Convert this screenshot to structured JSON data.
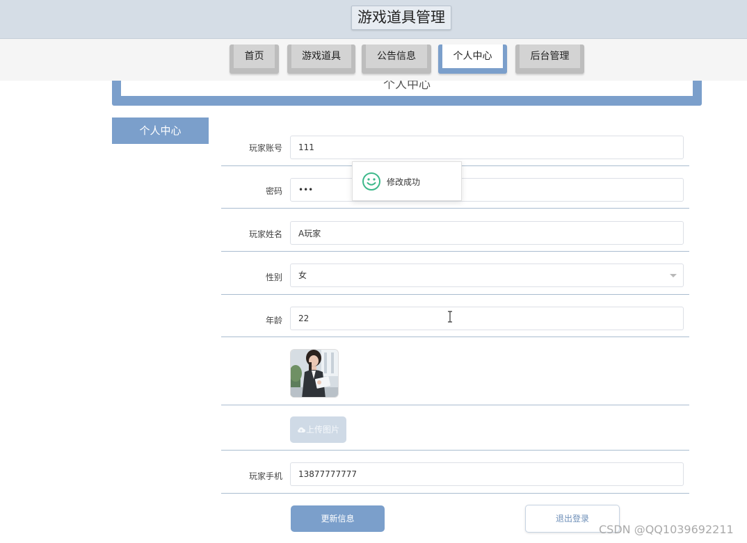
{
  "site": {
    "title": "游戏道具管理"
  },
  "nav": {
    "items": [
      {
        "label": "首页"
      },
      {
        "label": "游戏道具"
      },
      {
        "label": "公告信息"
      },
      {
        "label": "个人中心"
      },
      {
        "label": "后台管理"
      }
    ],
    "active": "个人中心"
  },
  "banner": {
    "title": "个人中心"
  },
  "sidebar": {
    "active_tab": "个人中心"
  },
  "form": {
    "account": {
      "label": "玩家账号",
      "value": "111"
    },
    "password": {
      "label": "密码",
      "value": "111"
    },
    "name": {
      "label": "玩家姓名",
      "value": "A玩家"
    },
    "gender": {
      "label": "性别",
      "value": "女"
    },
    "age": {
      "label": "年龄",
      "value": "22"
    },
    "upload_label": "上传图片",
    "phone": {
      "label": "玩家手机",
      "value": "13877777777"
    }
  },
  "buttons": {
    "update": "更新信息",
    "logout": "退出登录"
  },
  "toast": {
    "message": "修改成功",
    "icon": "smile-icon"
  },
  "watermark": "CSDN @QQ1039692211",
  "colors": {
    "accent": "#7b9fcb",
    "header_bg": "#d5dde6",
    "toast_icon": "#3cb88a"
  }
}
